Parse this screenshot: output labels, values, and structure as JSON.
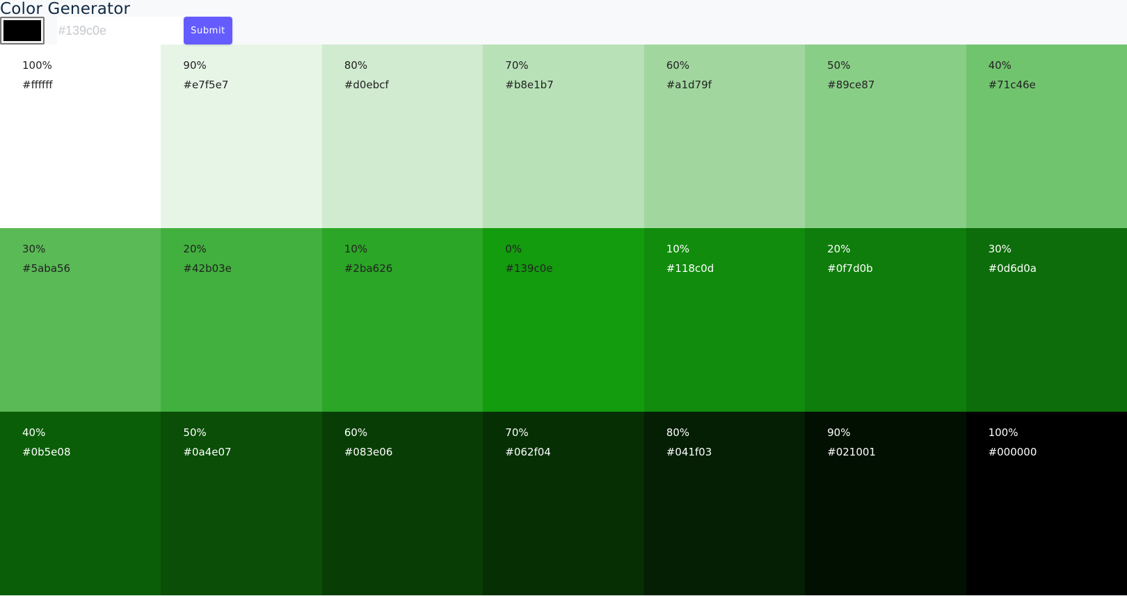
{
  "header": {
    "title": "Color Generator",
    "input_placeholder": "#139c0e",
    "submit_label": "Submit",
    "swatch_color": "#000000",
    "accent_color": "#645cff"
  },
  "tiles": [
    {
      "percent": "100%",
      "hex": "#ffffff",
      "tone": "light"
    },
    {
      "percent": "90%",
      "hex": "#e7f5e7",
      "tone": "light"
    },
    {
      "percent": "80%",
      "hex": "#d0ebcf",
      "tone": "light"
    },
    {
      "percent": "70%",
      "hex": "#b8e1b7",
      "tone": "light"
    },
    {
      "percent": "60%",
      "hex": "#a1d79f",
      "tone": "light"
    },
    {
      "percent": "50%",
      "hex": "#89ce87",
      "tone": "light"
    },
    {
      "percent": "40%",
      "hex": "#71c46e",
      "tone": "light"
    },
    {
      "percent": "30%",
      "hex": "#5aba56",
      "tone": "light"
    },
    {
      "percent": "20%",
      "hex": "#42b03e",
      "tone": "light"
    },
    {
      "percent": "10%",
      "hex": "#2ba626",
      "tone": "light"
    },
    {
      "percent": "0%",
      "hex": "#139c0e",
      "tone": "light"
    },
    {
      "percent": "10%",
      "hex": "#118c0d",
      "tone": "dark"
    },
    {
      "percent": "20%",
      "hex": "#0f7d0b",
      "tone": "dark"
    },
    {
      "percent": "30%",
      "hex": "#0d6d0a",
      "tone": "dark"
    },
    {
      "percent": "40%",
      "hex": "#0b5e08",
      "tone": "dark"
    },
    {
      "percent": "50%",
      "hex": "#0a4e07",
      "tone": "dark"
    },
    {
      "percent": "60%",
      "hex": "#083e06",
      "tone": "dark"
    },
    {
      "percent": "70%",
      "hex": "#062f04",
      "tone": "dark"
    },
    {
      "percent": "80%",
      "hex": "#041f03",
      "tone": "dark"
    },
    {
      "percent": "90%",
      "hex": "#021001",
      "tone": "dark"
    },
    {
      "percent": "100%",
      "hex": "#000000",
      "tone": "dark"
    }
  ]
}
